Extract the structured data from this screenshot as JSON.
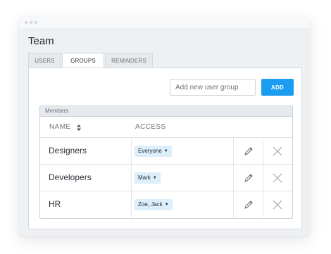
{
  "page": {
    "title": "Team"
  },
  "tabs": [
    {
      "label": "USERS",
      "active": false
    },
    {
      "label": "GROUPS",
      "active": true
    },
    {
      "label": "REMINDERS",
      "active": false
    }
  ],
  "new_group": {
    "placeholder": "Add new user group",
    "value": "",
    "add_label": "ADD"
  },
  "members": {
    "section_label": "Members",
    "columns": {
      "name": "NAME",
      "access": "ACCESS"
    },
    "rows": [
      {
        "name": "Designers",
        "access": "Everyone"
      },
      {
        "name": "Developers",
        "access": "Mark"
      },
      {
        "name": "HR",
        "access": "Zoe, Jack"
      }
    ]
  },
  "icons": {
    "sort": "sort-icon",
    "edit": "pencil-icon",
    "delete": "close-icon",
    "dropdown": "caret-down-icon"
  },
  "colors": {
    "accent": "#1a9cf0",
    "badge_bg": "#dbeef9",
    "background": "#eef1f4",
    "panel": "#ffffff"
  }
}
